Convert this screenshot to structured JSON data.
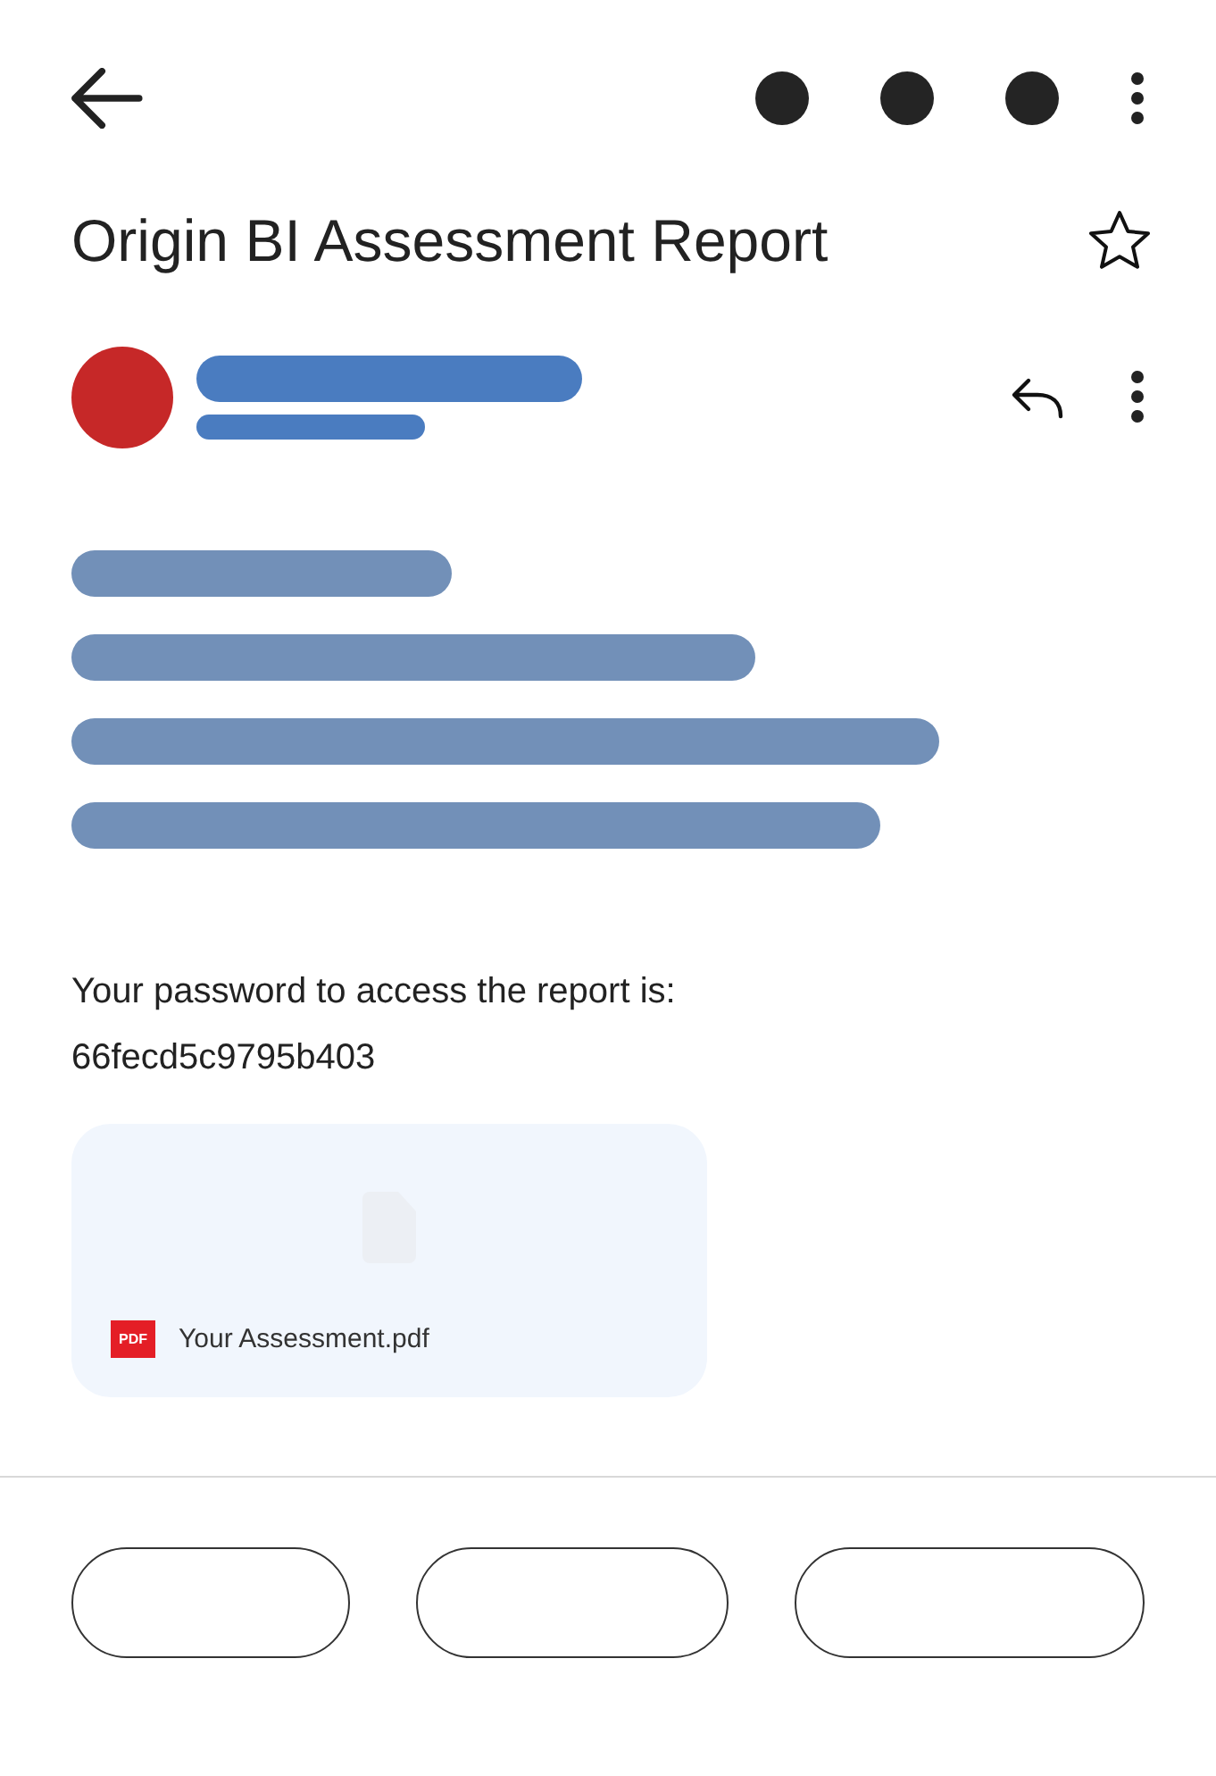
{
  "subject": "Origin BI Assessment Report",
  "starred": false,
  "message": [
    "Your password to access the report is:",
    "66fecd5c9795b403"
  ],
  "attachment": {
    "type": "PDF",
    "name": "Your Assessment.pdf"
  }
}
